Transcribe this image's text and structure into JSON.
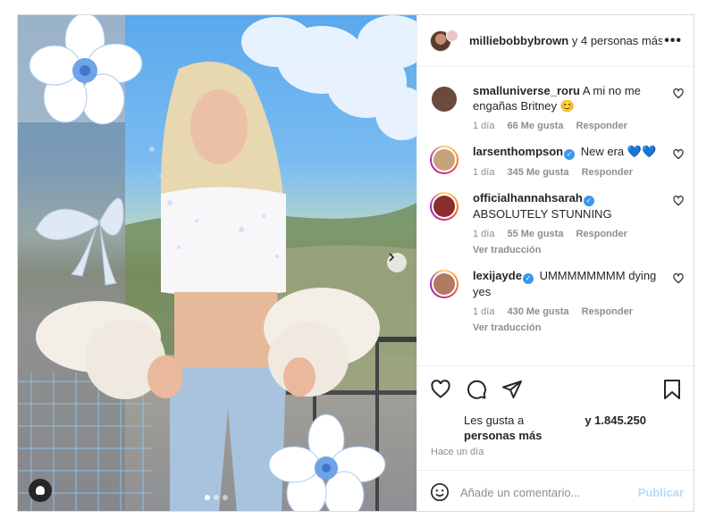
{
  "post": {
    "header": {
      "username": "milliebobbybrown",
      "coauthors": "y 4 personas más",
      "more_icon": "more-horizontal-icon"
    },
    "photo": {
      "carousel_dots": 3,
      "active_dot": 1,
      "next_icon": "chevron-right-icon"
    },
    "comments": [
      {
        "username": "smalluniverse_roru",
        "verified": false,
        "text": "A mi no me engañas Britney 😊",
        "time": "1 día",
        "likes": "66 Me gusta",
        "reply": "Responder",
        "translate": "",
        "avatar_color": "#6b4a3c"
      },
      {
        "username": "larsenthompson",
        "verified": true,
        "text": "New era 💙💙",
        "time": "1 día",
        "likes": "345 Me gusta",
        "reply": "Responder",
        "translate": "",
        "avatar_color": "#c9a27c"
      },
      {
        "username": "officialhannahsarah",
        "verified": true,
        "text": "ABSOLUTELY STUNNING",
        "time": "1 día",
        "likes": "55 Me gusta",
        "reply": "Responder",
        "translate": "Ver traducción",
        "avatar_color": "#8a2d2d"
      },
      {
        "username": "lexijayde",
        "verified": true,
        "text": "UMMMMMMMM dying yes",
        "time": "1 día",
        "likes": "430 Me gusta",
        "reply": "Responder",
        "translate": "Ver traducción",
        "avatar_color": "#b07a63"
      }
    ],
    "likes_line1_prefix": "Les gusta a",
    "likes_line1_suffix": "y 1.845.250",
    "likes_line2": "personas más",
    "time_ago": "Hace un día",
    "comment_placeholder": "Añade un comentario...",
    "publish_label": "Publicar",
    "colors": {
      "accent": "#3897f0",
      "publish_disabled": "#b3dbff",
      "muted": "#8e8e8e"
    }
  }
}
